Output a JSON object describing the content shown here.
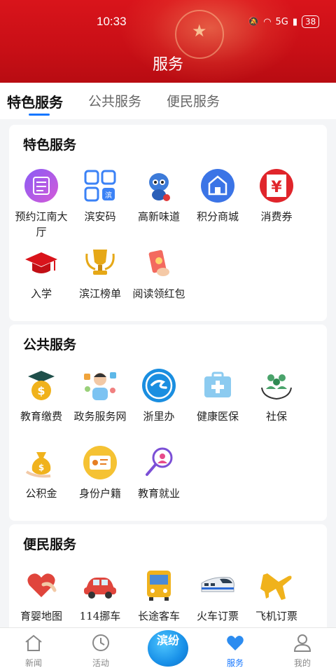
{
  "status_bar": {
    "time": "10:33",
    "signal": "5G",
    "battery": "38"
  },
  "header": {
    "title": "服务"
  },
  "tabs": [
    {
      "label": "特色服务",
      "active": true
    },
    {
      "label": "公共服务",
      "active": false
    },
    {
      "label": "便民服务",
      "active": false
    }
  ],
  "sections": [
    {
      "title": "特色服务",
      "items": [
        {
          "label": "预约江南大厅",
          "icon": "calendar-icon"
        },
        {
          "label": "滨安码",
          "icon": "qr-code-icon"
        },
        {
          "label": "高新味道",
          "icon": "mascot-icon"
        },
        {
          "label": "积分商城",
          "icon": "shop-icon"
        },
        {
          "label": "消费券",
          "icon": "yuan-coupon-icon"
        },
        {
          "label": "入学",
          "icon": "graduation-cap-icon"
        },
        {
          "label": "滨江榜单",
          "icon": "trophy-icon"
        },
        {
          "label": "阅读领红包",
          "icon": "red-envelope-icon"
        }
      ]
    },
    {
      "title": "公共服务",
      "items": [
        {
          "label": "教育缴费",
          "icon": "education-fee-icon"
        },
        {
          "label": "政务服务网",
          "icon": "government-service-icon"
        },
        {
          "label": "浙里办",
          "icon": "zheli-ban-icon"
        },
        {
          "label": "健康医保",
          "icon": "medical-kit-icon"
        },
        {
          "label": "社保",
          "icon": "social-security-icon"
        },
        {
          "label": "公积金",
          "icon": "money-bag-icon"
        },
        {
          "label": "身份户籍",
          "icon": "id-card-icon"
        },
        {
          "label": "教育就业",
          "icon": "search-person-icon"
        }
      ]
    },
    {
      "title": "便民服务",
      "items": [
        {
          "label": "育婴地图",
          "icon": "heart-hand-icon"
        },
        {
          "label": "114挪车",
          "icon": "car-icon"
        },
        {
          "label": "长途客车",
          "icon": "bus-icon"
        },
        {
          "label": "火车订票",
          "icon": "train-icon"
        },
        {
          "label": "飞机订票",
          "icon": "airplane-icon"
        }
      ]
    }
  ],
  "bottom_nav": [
    {
      "label": "新闻",
      "icon": "home-icon",
      "active": false
    },
    {
      "label": "活动",
      "icon": "clock-icon",
      "active": false
    },
    {
      "label": "滨纷",
      "icon": "center-logo-icon",
      "active": false
    },
    {
      "label": "服务",
      "icon": "heart-icon",
      "active": true
    },
    {
      "label": "我的",
      "icon": "user-icon",
      "active": false
    }
  ],
  "colors": {
    "header_red": "#d9141b",
    "accent_blue": "#1677ff"
  }
}
